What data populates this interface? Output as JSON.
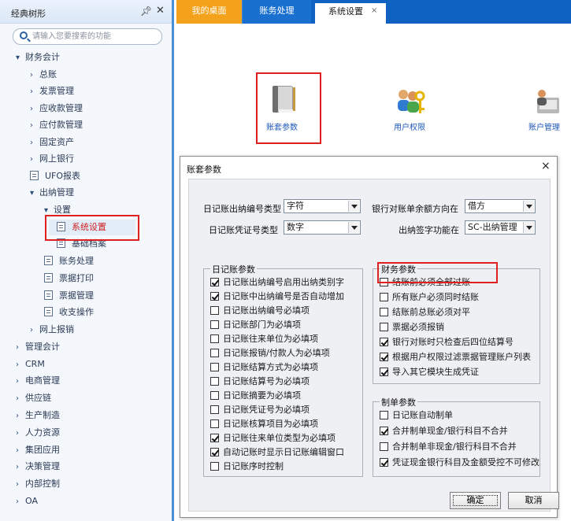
{
  "sidebar": {
    "title": "经典树形",
    "search_placeholder": "请输入您要搜索的功能",
    "items": [
      {
        "label": "财务会计",
        "arrow": "▾"
      },
      {
        "label": "总账",
        "arrow": "›"
      },
      {
        "label": "发票管理",
        "arrow": "›"
      },
      {
        "label": "应收款管理",
        "arrow": "›"
      },
      {
        "label": "应付款管理",
        "arrow": "›"
      },
      {
        "label": "固定资产",
        "arrow": "›"
      },
      {
        "label": "网上银行",
        "arrow": "›"
      },
      {
        "label": "UFO报表",
        "arrow": ""
      },
      {
        "label": "出纳管理",
        "arrow": "▾"
      },
      {
        "label": "设置",
        "arrow": "▾"
      },
      {
        "label": "系统设置",
        "arrow": ""
      },
      {
        "label": "基础档案",
        "arrow": ""
      },
      {
        "label": "账务处理",
        "arrow": ""
      },
      {
        "label": "票据打印",
        "arrow": ""
      },
      {
        "label": "票据管理",
        "arrow": ""
      },
      {
        "label": "收支操作",
        "arrow": ""
      },
      {
        "label": "网上报销",
        "arrow": "›"
      },
      {
        "label": "管理会计",
        "arrow": "›"
      },
      {
        "label": "CRM",
        "arrow": "›"
      },
      {
        "label": "电商管理",
        "arrow": "›"
      },
      {
        "label": "供应链",
        "arrow": "›"
      },
      {
        "label": "生产制造",
        "arrow": "›"
      },
      {
        "label": "人力资源",
        "arrow": "›"
      },
      {
        "label": "集团应用",
        "arrow": "›"
      },
      {
        "label": "决策管理",
        "arrow": "›"
      },
      {
        "label": "内部控制",
        "arrow": "›"
      },
      {
        "label": "OA",
        "arrow": "›"
      }
    ]
  },
  "tabs": {
    "desktop": "我的桌面",
    "accounting": "账务处理",
    "settings": "系统设置",
    "close_glyph": "×"
  },
  "desktop_icons": {
    "account_params": "账套参数",
    "user_rights": "用户权限",
    "account_mgmt": "账户管理"
  },
  "dialog": {
    "title": "账套参数",
    "close_glyph": "×",
    "fields": {
      "journal_no_type_label": "日记账出纳编号类型",
      "journal_no_type_value": "字符",
      "bank_balance_dir_label": "银行对账单余额方向在",
      "bank_balance_dir_value": "借方",
      "voucher_no_type_label": "日记账凭证号类型",
      "voucher_no_type_value": "数字",
      "cashier_sign_label": "出纳签字功能在",
      "cashier_sign_value": "SC-出纳管理"
    },
    "journal_params": {
      "title": "日记账参数",
      "items": [
        {
          "label": "日记账出纳编号启用出纳类别字",
          "checked": true
        },
        {
          "label": "日记账中出纳编号是否自动增加",
          "checked": true
        },
        {
          "label": "日记账出纳编号必填项",
          "checked": false
        },
        {
          "label": "日记账部门为必填项",
          "checked": false
        },
        {
          "label": "日记账往来单位为必填项",
          "checked": false
        },
        {
          "label": "日记账报销/付款人为必填项",
          "checked": false
        },
        {
          "label": "日记账结算方式为必填项",
          "checked": false
        },
        {
          "label": "日记账结算号为必填项",
          "checked": false
        },
        {
          "label": "日记账摘要为必填项",
          "checked": false
        },
        {
          "label": "日记账凭证号为必填项",
          "checked": false
        },
        {
          "label": "日记账核算项目为必填项",
          "checked": false
        },
        {
          "label": "日记账往来单位类型为必填项",
          "checked": true
        },
        {
          "label": "自动记账时显示日记账编辑窗口",
          "checked": true
        },
        {
          "label": "日记账序时控制",
          "checked": false
        }
      ]
    },
    "finance_params": {
      "title": "财务参数",
      "items": [
        {
          "label": "结账前必须全部过账",
          "checked": false
        },
        {
          "label": "所有账户必须同时结账",
          "checked": false
        },
        {
          "label": "结账前总账必须对平",
          "checked": false
        },
        {
          "label": "票据必须报销",
          "checked": false
        },
        {
          "label": "银行对账时只检查后四位结算号",
          "checked": true
        },
        {
          "label": "根据用户权限过滤票据管理账户列表",
          "checked": true
        },
        {
          "label": "导入其它模块生成凭证",
          "checked": true
        }
      ]
    },
    "voucher_params": {
      "title": "制单参数",
      "items": [
        {
          "label": "日记账自动制单",
          "checked": false
        },
        {
          "label": "合并制单现金/银行科目不合并",
          "checked": true
        },
        {
          "label": "合并制单非现金/银行科目不合并",
          "checked": false
        },
        {
          "label": "凭证现金银行科目及金额受控不可修改",
          "checked": true
        }
      ]
    },
    "ok_label": "确定",
    "cancel_label": "取消"
  }
}
